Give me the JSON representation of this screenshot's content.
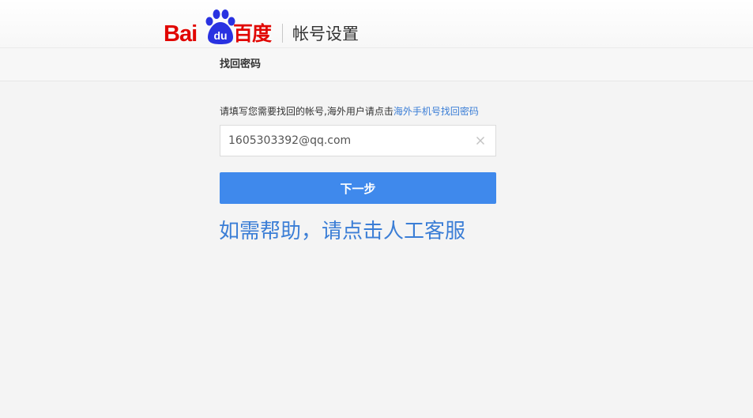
{
  "header": {
    "logo_text_latin": "Bai",
    "logo_paw_text": "du",
    "logo_text_cn": "百度",
    "title": "帐号设置"
  },
  "subbar": {
    "title": "找回密码"
  },
  "form": {
    "instruction_text": "请填写您需要找回的帐号,海外用户请点击",
    "overseas_link": "海外手机号找回密码",
    "account_value": "1605303392@qq.com",
    "next_label": "下一步"
  },
  "help": {
    "text": "如需帮助，请点击人工客服"
  },
  "colors": {
    "brand_red": "#e10602",
    "brand_blue": "#2932e1",
    "button_blue": "#3f89ec",
    "link_blue": "#3b7ed6",
    "background": "#f4f4f4"
  },
  "icons": {
    "logo": "baidu-paw-icon",
    "clear": "close-icon"
  }
}
